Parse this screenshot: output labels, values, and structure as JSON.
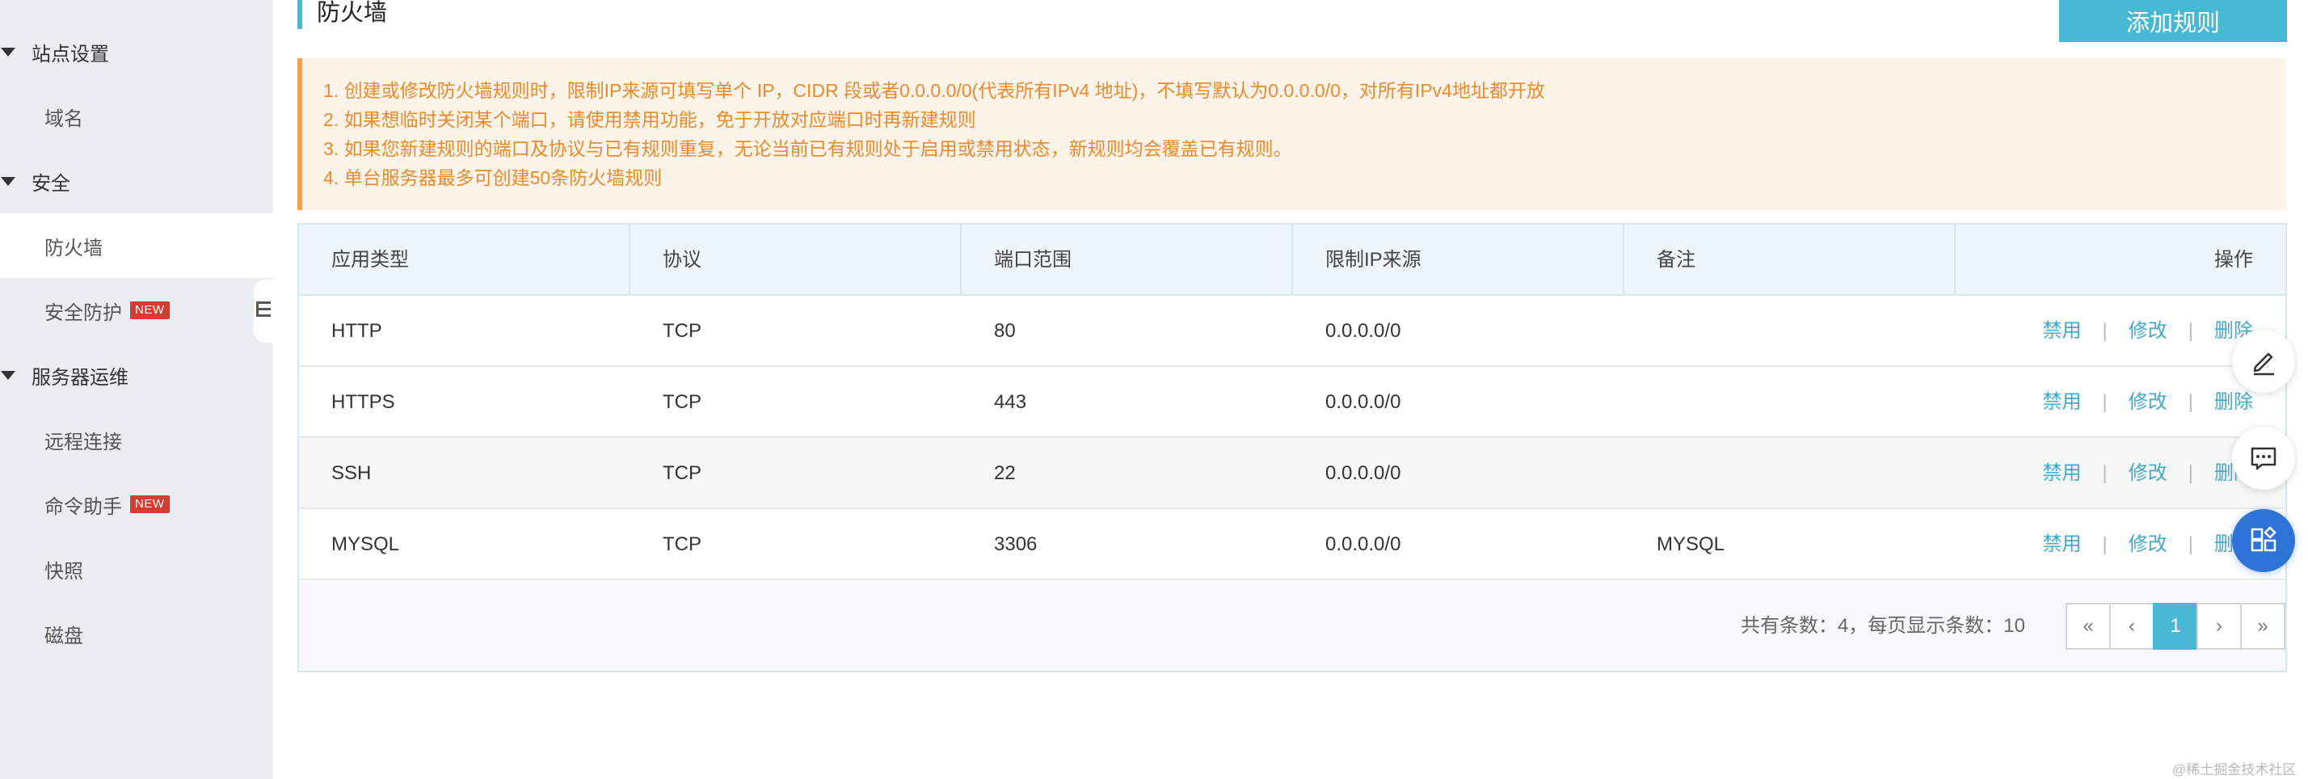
{
  "sidebar": {
    "groups": [
      {
        "label": "站点设置"
      },
      {
        "label": "安全"
      },
      {
        "label": "服务器运维"
      }
    ],
    "items": [
      {
        "label": "域名",
        "badge": ""
      },
      {
        "label": "防火墙",
        "badge": ""
      },
      {
        "label": "安全防护",
        "badge": "NEW"
      },
      {
        "label": "远程连接",
        "badge": ""
      },
      {
        "label": "命令助手",
        "badge": "NEW"
      },
      {
        "label": "快照",
        "badge": ""
      },
      {
        "label": "磁盘",
        "badge": ""
      }
    ],
    "active_item": "防火墙"
  },
  "page": {
    "title": "防火墙",
    "add_button": "添加规则"
  },
  "notice": {
    "lines": [
      "1. 创建或修改防火墙规则时，限制IP来源可填写单个 IP，CIDR 段或者0.0.0.0/0(代表所有IPv4 地址)，不填写默认为0.0.0.0/0，对所有IPv4地址都开放",
      "2. 如果想临时关闭某个端口，请使用禁用功能，免于开放对应端口时再新建规则",
      "3. 如果您新建规则的端口及协议与已有规则重复，无论当前已有规则处于启用或禁用状态，新规则均会覆盖已有规则。",
      "4. 单台服务器最多可创建50条防火墙规则"
    ]
  },
  "table": {
    "headers": [
      "应用类型",
      "协议",
      "端口范围",
      "限制IP来源",
      "备注",
      "操作"
    ],
    "rows": [
      {
        "app": "HTTP",
        "protocol": "TCP",
        "port": "80",
        "source": "0.0.0.0/0",
        "remark": ""
      },
      {
        "app": "HTTPS",
        "protocol": "TCP",
        "port": "443",
        "source": "0.0.0.0/0",
        "remark": ""
      },
      {
        "app": "SSH",
        "protocol": "TCP",
        "port": "22",
        "source": "0.0.0.0/0",
        "remark": ""
      },
      {
        "app": "MYSQL",
        "protocol": "TCP",
        "port": "3306",
        "source": "0.0.0.0/0",
        "remark": "MYSQL"
      }
    ],
    "actions": {
      "disable": "禁用",
      "edit": "修改",
      "delete": "删除",
      "separator": "|"
    }
  },
  "pagination": {
    "summary": "共有条数：4，每页显示条数：10",
    "first": "«",
    "prev": "‹",
    "current": "1",
    "next": "›",
    "last": "»"
  },
  "float_tools": {
    "icons": [
      "edit-icon",
      "feedback-icon",
      "apps-icon"
    ],
    "primary_color": "#2e73d6"
  },
  "watermark": "@稀土掘金技术社区",
  "colors": {
    "accent": "#49b8d4",
    "link": "#41a9cf",
    "notice_text": "#e88b2e",
    "notice_bg": "#fdf3e8",
    "badge": "#d63b30"
  }
}
